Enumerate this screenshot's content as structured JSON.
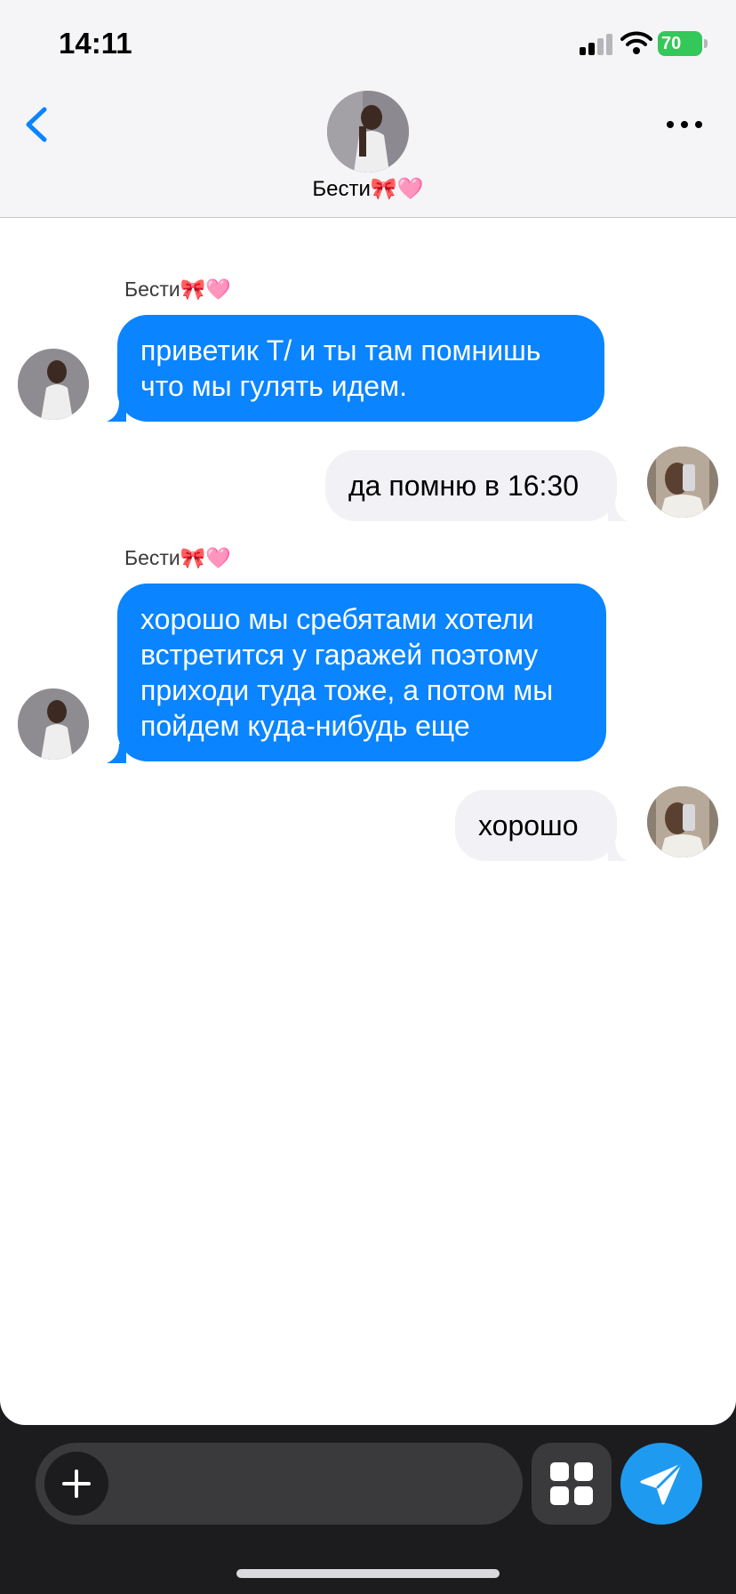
{
  "status_bar": {
    "time": "14:11",
    "battery": "70",
    "icons": [
      "signal-icon",
      "wifi-icon",
      "battery-icon"
    ]
  },
  "header": {
    "contact_name": "Бести🎀🩷",
    "icons": [
      "back-chevron-icon",
      "more-icon"
    ]
  },
  "messages": [
    {
      "direction": "in",
      "sender": "Бести🎀🩷",
      "text": "приветик Т/ и ты там помнишь что мы гулять идем."
    },
    {
      "direction": "out",
      "sender": "",
      "text": "да помню в 16:30"
    },
    {
      "direction": "in",
      "sender": "Бести🎀🩷",
      "text": "хорошо мы сребятами хотели встретится у гаражей поэтому приходи туда тоже, а потом мы пойдем куда-нибудь еще"
    },
    {
      "direction": "out",
      "sender": "",
      "text": "хорошо"
    }
  ],
  "composer": {
    "placeholder": "",
    "icons": [
      "plus-icon",
      "grid-icon",
      "send-icon"
    ]
  },
  "colors": {
    "incoming_bubble": "#0a84ff",
    "outgoing_bubble": "#f1f1f6",
    "accent": "#1e9bf0",
    "battery": "#34c759"
  }
}
